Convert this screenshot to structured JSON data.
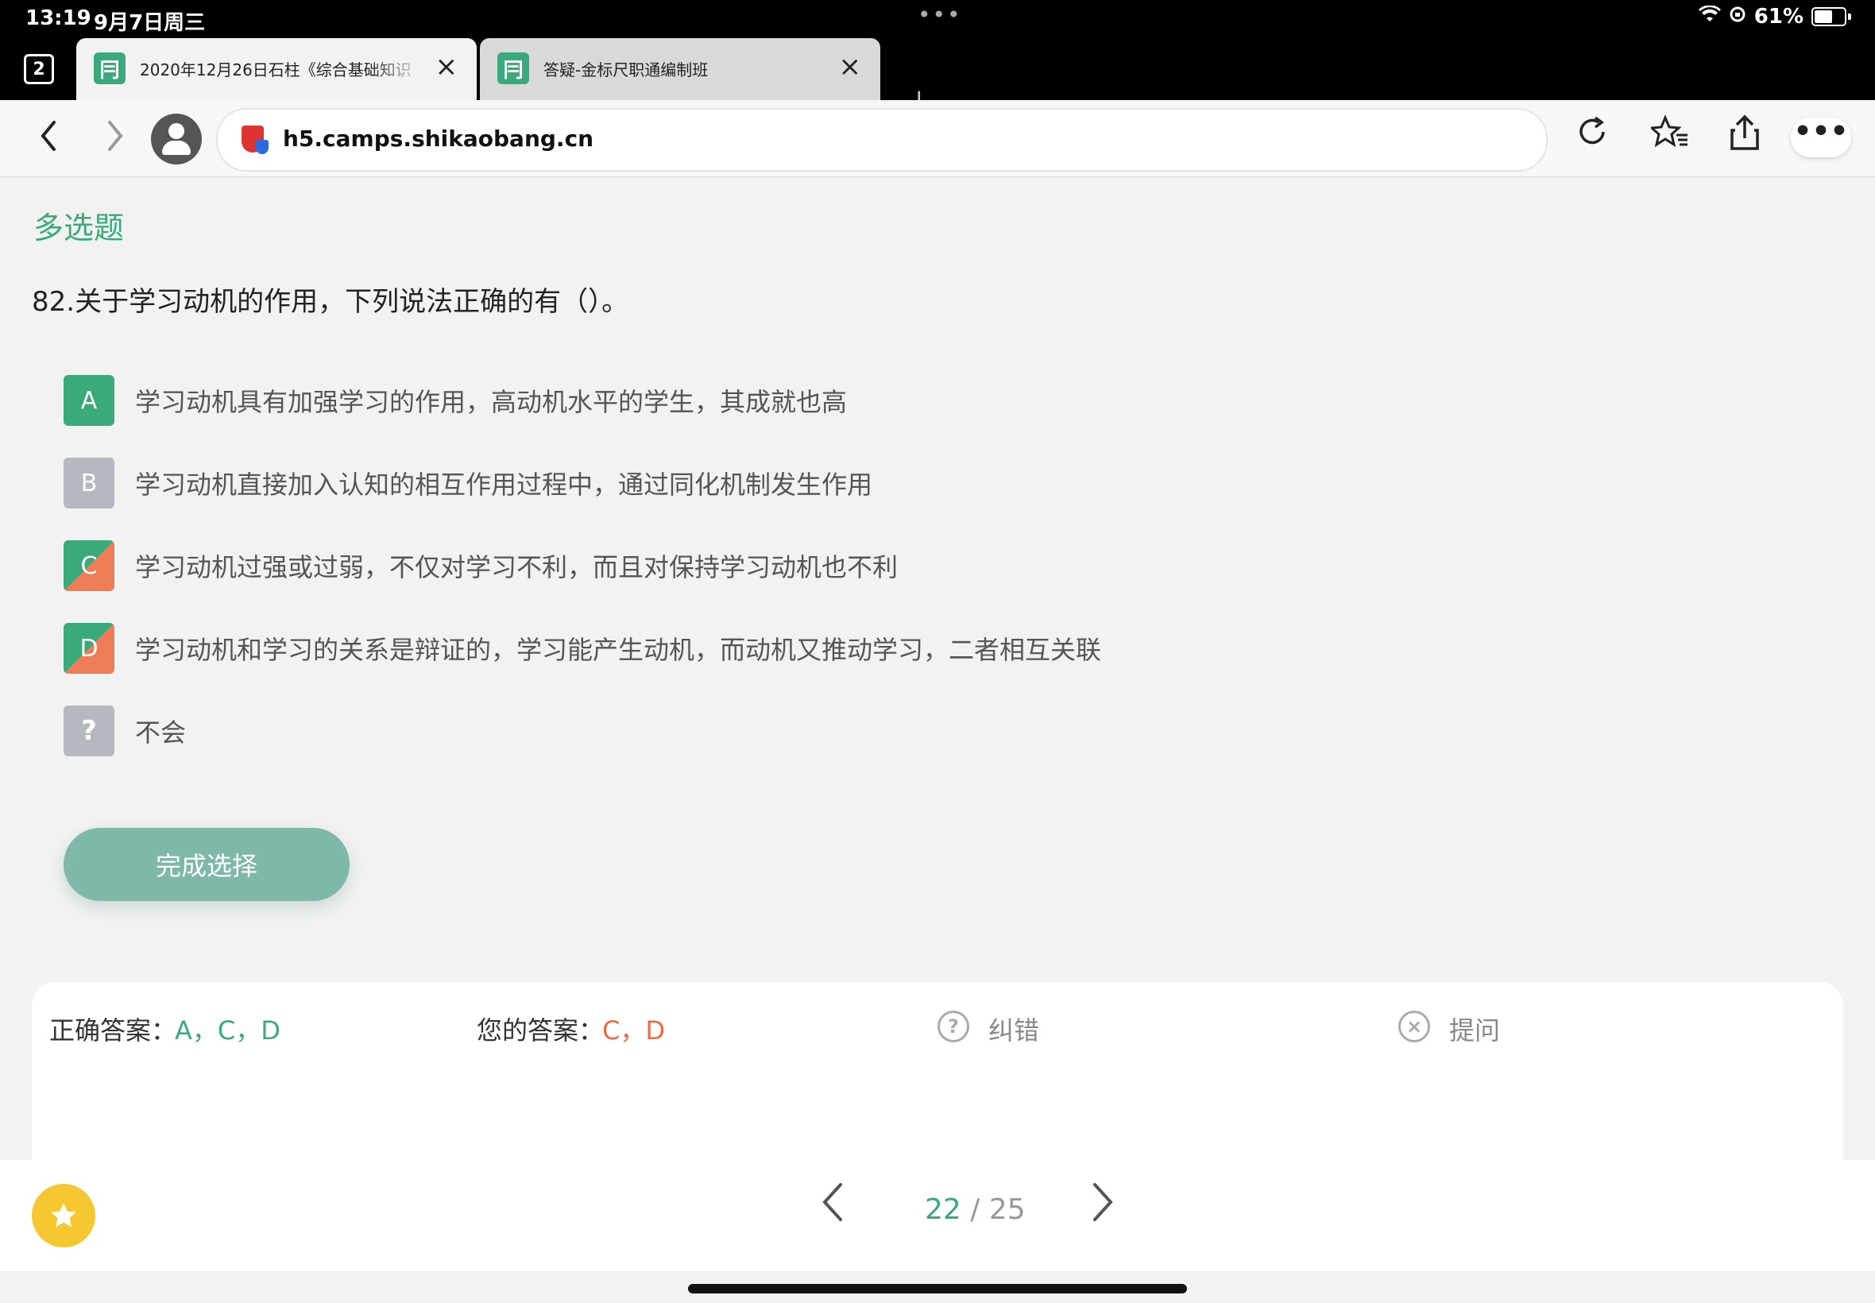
{
  "status_bar": {
    "time": "13:19",
    "date": "9月7日周三",
    "dots": "•••",
    "battery": "61%"
  },
  "tabs": {
    "count": "2",
    "items": [
      {
        "title": "2020年12月26日石柱《综合基础知识",
        "active": true
      },
      {
        "title": "答疑-金标尺职通编制班",
        "active": false
      }
    ],
    "close_glyph": "×",
    "new_tab_glyph": "+"
  },
  "address_bar": {
    "url": "h5.camps.shikaobang.cn",
    "back_glyph": "‹",
    "forward_glyph": "›",
    "more_glyph": "•••"
  },
  "question": {
    "type": "多选题",
    "text": "82.关于学习动机的作用，下列说法正确的有（）。",
    "options": [
      {
        "label": "A",
        "text": "学习动机具有加强学习的作用，高动机水平的学生，其成就也高",
        "state": "correct-missed"
      },
      {
        "label": "B",
        "text": "学习动机直接加入认知的相互作用过程中，通过同化机制发生作用",
        "state": "unselected"
      },
      {
        "label": "C",
        "text": "学习动机过强或过弱，不仅对学习不利，而且对保持学习动机也不利",
        "state": "correct-selected"
      },
      {
        "label": "D",
        "text": "学习动机和学习的关系是辩证的，学习能产生动机，而动机又推动学习，二者相互关联",
        "state": "correct-selected"
      },
      {
        "label": "?",
        "text": "不会",
        "state": "unselected"
      }
    ],
    "submit_label": "完成选择"
  },
  "answer_card": {
    "correct_label": "正确答案：",
    "correct_value": "A，C，D",
    "yours_label": "您的答案：",
    "yours_value": "C，D",
    "report_label": "纠错",
    "ask_label": "提问"
  },
  "pagination": {
    "current": "22",
    "separator": " / ",
    "total": "25"
  },
  "colors": {
    "accent": "#3aa97c",
    "wrong": "#ee6a45",
    "neutral": "#b5b8be",
    "star": "#f5c730"
  }
}
